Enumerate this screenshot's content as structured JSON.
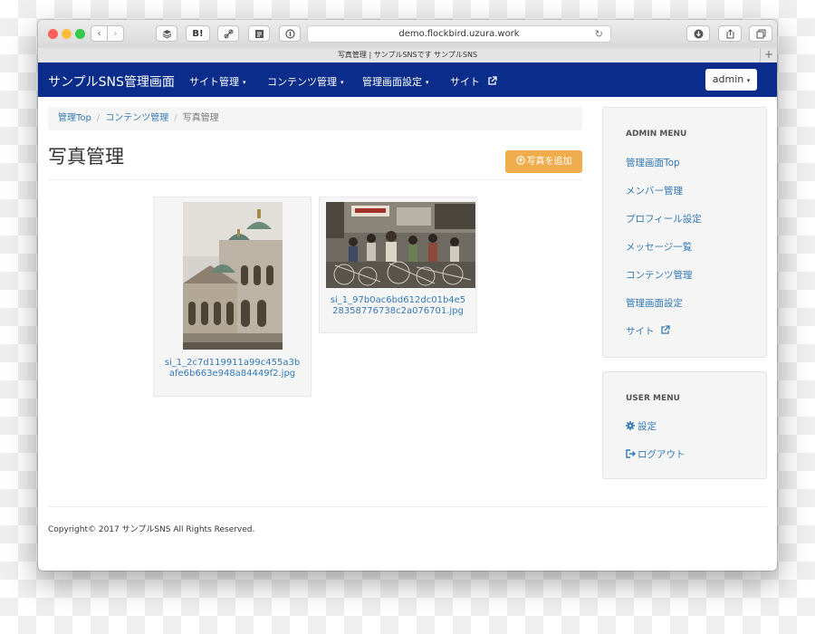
{
  "browser": {
    "url": "demo.flockbird.uzura.work",
    "tab_title": "写真管理 | サンプルSNSです サンプルSNS",
    "hatena_label": "B!",
    "new_tab_label": "+"
  },
  "navbar": {
    "brand": "サンプルSNS管理画面",
    "items": [
      {
        "label": "サイト管理",
        "caret": "▾"
      },
      {
        "label": "コンテンツ管理",
        "caret": "▾"
      },
      {
        "label": "管理画面設定",
        "caret": "▾"
      },
      {
        "label": "サイト",
        "caret": ""
      }
    ],
    "user_button": "admin",
    "user_caret": "▾"
  },
  "breadcrumb": {
    "items": [
      "管理Top",
      "コンテンツ管理",
      "写真管理"
    ],
    "separator": "/"
  },
  "page": {
    "title": "写真管理",
    "add_button": "写真を追加"
  },
  "photos": [
    {
      "caption_line1": "si_1_2c7d119911a99c455a3b",
      "caption_line2": "afe6b663e948a84449f2.jpg",
      "image": "cathedral-photo"
    },
    {
      "caption_line1": "si_1_97b0ac6bd612dc01b4e5",
      "caption_line2": "28358776738c2a076701.jpg",
      "image": "street-market-photo"
    }
  ],
  "sidebar": {
    "admin_menu": {
      "heading": "ADMIN MENU",
      "items": [
        "管理画面Top",
        "メンバー管理",
        "プロフィール設定",
        "メッセージ一覧",
        "コンテンツ管理",
        "管理画面設定",
        "サイト"
      ]
    },
    "user_menu": {
      "heading": "USER MENU",
      "items": [
        "設定",
        "ログアウト"
      ]
    }
  },
  "footer": {
    "copyright": "Copyright© 2017 サンプルSNS All Rights Reserved."
  },
  "colors": {
    "navbar": "#0a2c8a",
    "link": "#337ab7",
    "add_button": "#f0ad4e"
  }
}
